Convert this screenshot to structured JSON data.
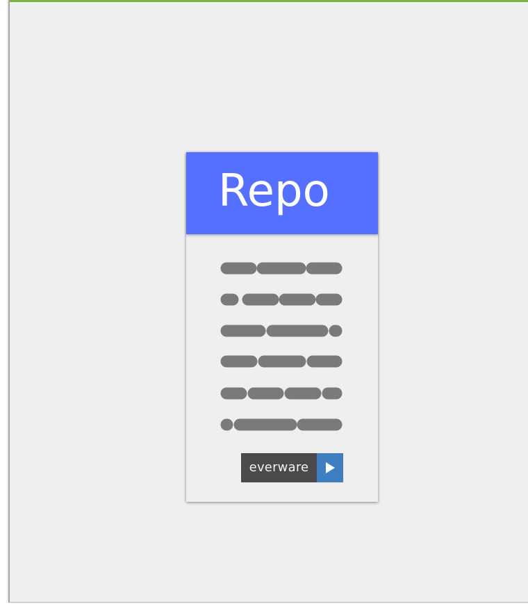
{
  "card": {
    "title": "Repo",
    "header_color": "#5570ff",
    "placeholder_line_color": "#7a7a7a",
    "badge": {
      "label": "everware",
      "play_icon": "play-icon",
      "label_bg": "#4a4a4a",
      "play_bg": "#3f7fc0"
    }
  },
  "frame": {
    "accent_color": "#7cb342"
  }
}
